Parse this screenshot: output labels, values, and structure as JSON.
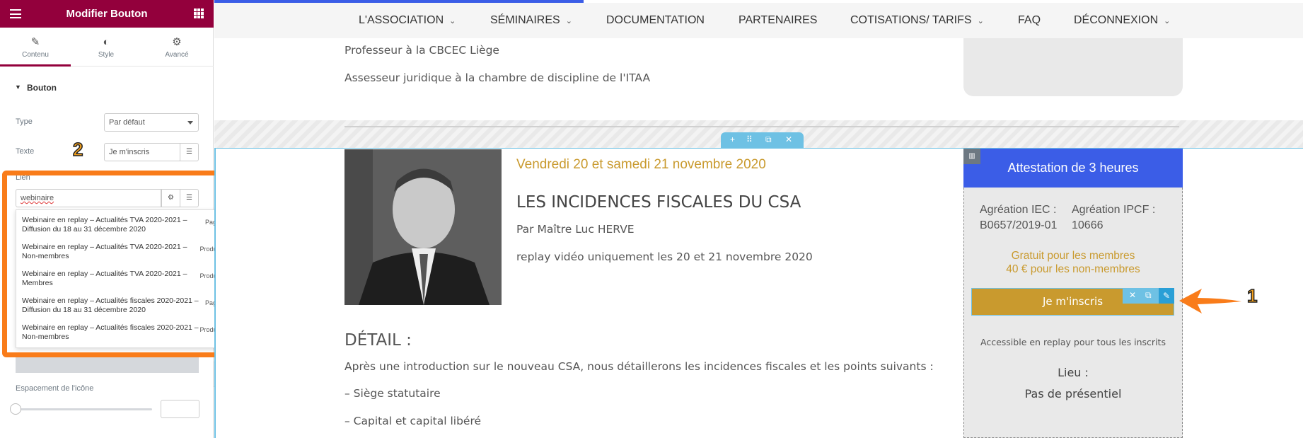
{
  "panel": {
    "title": "Modifier Bouton",
    "tabs": [
      {
        "label": "Contenu",
        "icon": "pencil-icon"
      },
      {
        "label": "Style",
        "icon": "half-circle-icon"
      },
      {
        "label": "Avancé",
        "icon": "gear-icon"
      }
    ],
    "section_title": "Bouton",
    "type_label": "Type",
    "type_value": "Par défaut",
    "text_label": "Texte",
    "text_value": "Je m'inscris",
    "link_label": "Lien",
    "link_value": "webinaire",
    "suggestions": [
      {
        "title": "Webinaire en replay – Actualités TVA 2020-2021 – Diffusion du 18 au 31 décembre 2020",
        "kind": "Page"
      },
      {
        "title": "Webinaire en replay – Actualités TVA 2020-2021 – Non-membres",
        "kind": "Produit"
      },
      {
        "title": "Webinaire en replay – Actualités TVA 2020-2021 – Membres",
        "kind": "Produit"
      },
      {
        "title": "Webinaire en replay – Actualités fiscales 2020-2021 – Diffusion du 18 au 31 décembre 2020",
        "kind": "Page"
      },
      {
        "title": "Webinaire en replay – Actualités fiscales 2020-2021 – Non-membres",
        "kind": "Produit"
      }
    ],
    "icon_spacing_label": "Espacement de l'icône"
  },
  "annotations": {
    "marker_1": "1",
    "marker_2": "2",
    "accent": "#f97c1a"
  },
  "nav": {
    "items": [
      {
        "label": "L'ASSOCIATION",
        "dropdown": true
      },
      {
        "label": "SÉMINAIRES",
        "dropdown": true
      },
      {
        "label": "DOCUMENTATION",
        "dropdown": false
      },
      {
        "label": "PARTENAIRES",
        "dropdown": false
      },
      {
        "label": "COTISATIONS/ TARIFS",
        "dropdown": true
      },
      {
        "label": "FAQ",
        "dropdown": false
      },
      {
        "label": "DÉCONNEXION",
        "dropdown": true
      }
    ]
  },
  "page": {
    "upper_line_1": "Professeur à la CBCEC Liège",
    "upper_line_2": "Assesseur juridique à la chambre de discipline de l'ITAA",
    "event_date": "Vendredi 20 et samedi 21 novembre 2020",
    "event_title": "LES INCIDENCES FISCALES DU CSA",
    "speaker": "Par Maître Luc HERVE",
    "replay_note": "replay vidéo uniquement les 20 et 21 novembre 2020",
    "detail_title": "DÉTAIL :",
    "detail_intro": "Après une introduction sur le nouveau CSA, nous détaillerons les incidences fiscales et les points suivants :",
    "bullets": [
      "– Siège statutaire",
      "– Capital et capital libéré"
    ]
  },
  "card": {
    "header": "Attestation de 3 heures",
    "agg_iec_label": "Agréation IEC :",
    "agg_iec_value": "B0657/2019-01",
    "agg_ipcf_label": "Agréation IPCF :",
    "agg_ipcf_value": "10666",
    "price_members": "Gratuit pour les membres",
    "price_nonmembers": "40 € pour les non-membres",
    "cta": "Je m'inscris",
    "access_note": "Accessible en replay pour tous les inscrits",
    "lieu_label": "Lieu :",
    "lieu_value": "Pas de présentiel"
  },
  "colors": {
    "brand": "#93003c",
    "gold": "#c99a2e",
    "blue": "#3b5de7",
    "editor_accent": "#6ec1e4"
  }
}
